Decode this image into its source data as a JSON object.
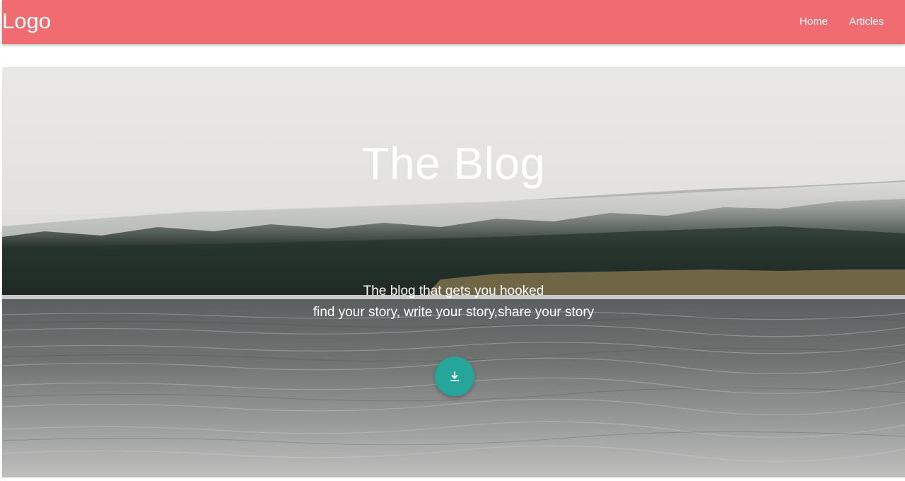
{
  "nav": {
    "brand": "Logo",
    "links": [
      "Home",
      "Articles"
    ]
  },
  "hero": {
    "title": "The Blog",
    "subtitle_line1": "The blog that gets you hooked",
    "subtitle_line2": "find your story, write your story,share your story",
    "action_icon": "download-icon"
  },
  "colors": {
    "navbar": "#f06c71",
    "fab": "#26a69a",
    "text": "#ffffff"
  }
}
